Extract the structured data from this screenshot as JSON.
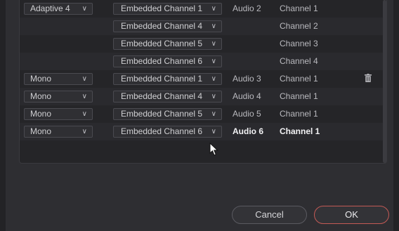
{
  "rows": [
    {
      "mode": "Adaptive 4",
      "channel": "Embedded Channel 1",
      "audio": "Audio 2",
      "track": "Channel 1"
    },
    {
      "mode": "",
      "channel": "Embedded Channel 4",
      "audio": "",
      "track": "Channel 2"
    },
    {
      "mode": "",
      "channel": "Embedded Channel 5",
      "audio": "",
      "track": "Channel 3"
    },
    {
      "mode": "",
      "channel": "Embedded Channel 6",
      "audio": "",
      "track": "Channel 4"
    },
    {
      "mode": "Mono",
      "channel": "Embedded Channel 1",
      "audio": "Audio 3",
      "track": "Channel 1"
    },
    {
      "mode": "Mono",
      "channel": "Embedded Channel 4",
      "audio": "Audio 4",
      "track": "Channel 1"
    },
    {
      "mode": "Mono",
      "channel": "Embedded Channel 5",
      "audio": "Audio 5",
      "track": "Channel 1"
    },
    {
      "mode": "Mono",
      "channel": "Embedded Channel 6",
      "audio": "Audio 6",
      "track": "Channel 1"
    }
  ],
  "chevron": "∨",
  "buttons": {
    "cancel": "Cancel",
    "ok": "OK"
  },
  "icons": {
    "trash": "trash-icon",
    "chevron": "chevron-down-icon",
    "cursor": "mouse-cursor-icon"
  },
  "colors": {
    "ok_border": "#c35a55",
    "panel": "#252528",
    "dialog": "#2e2e32"
  }
}
